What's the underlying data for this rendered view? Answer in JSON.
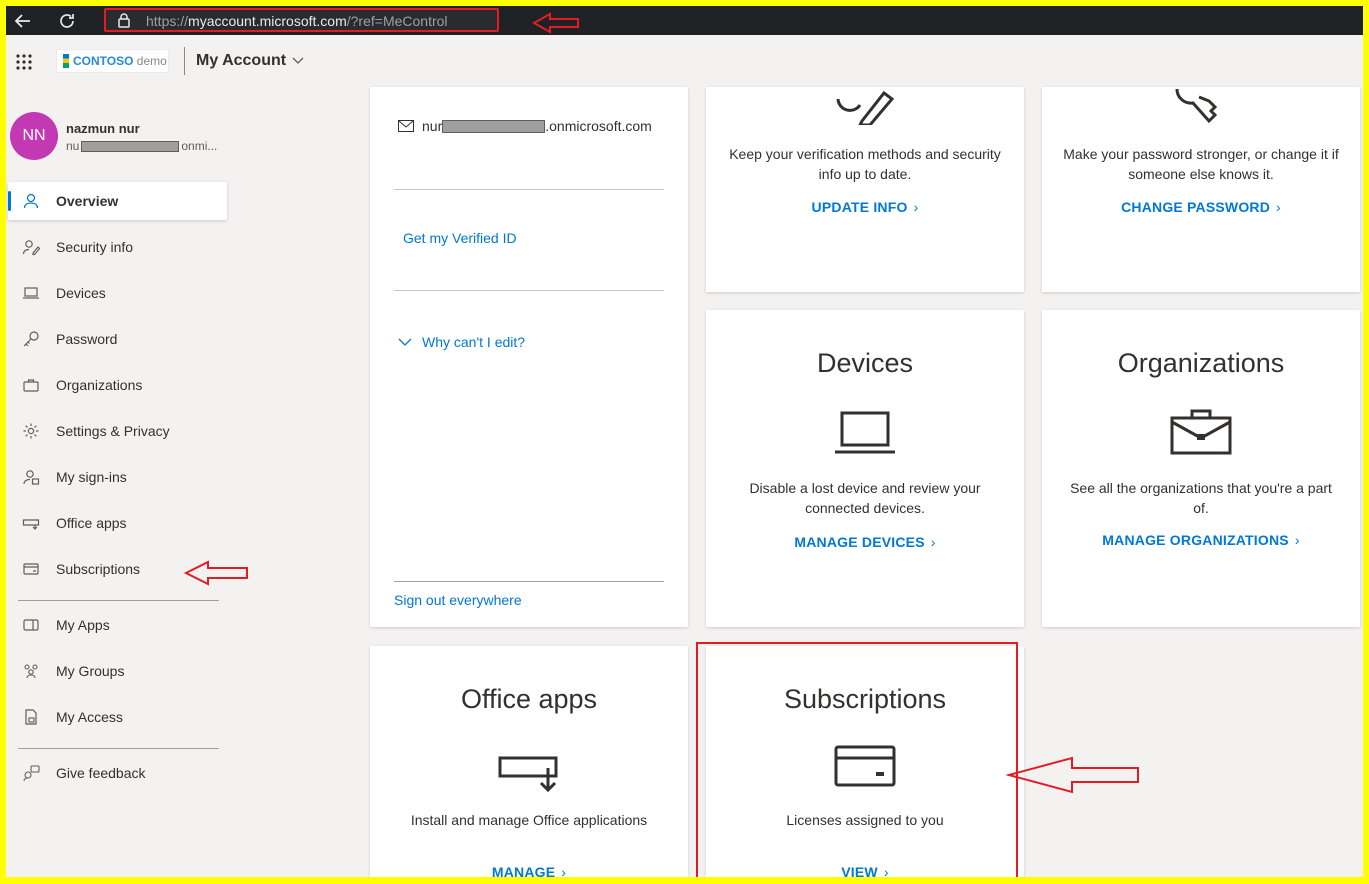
{
  "browser": {
    "url_prefix": "https://",
    "url_domain": "myaccount.microsoft.com",
    "url_suffix": "/?ref=MeControl"
  },
  "header": {
    "tenant_name": "CONTOSO",
    "tenant_suffix": "demo",
    "app_title": "My Account"
  },
  "user": {
    "initials": "NN",
    "name": "nazmun nur",
    "email_start": "nu",
    "email_end": "onmi..."
  },
  "sidebar": {
    "items": [
      {
        "label": "Overview",
        "icon": "person-icon"
      },
      {
        "label": "Security info",
        "icon": "security-info-icon"
      },
      {
        "label": "Devices",
        "icon": "laptop-icon"
      },
      {
        "label": "Password",
        "icon": "key-icon"
      },
      {
        "label": "Organizations",
        "icon": "briefcase-icon"
      },
      {
        "label": "Settings & Privacy",
        "icon": "gear-icon"
      },
      {
        "label": "My sign-ins",
        "icon": "sign-ins-icon"
      },
      {
        "label": "Office apps",
        "icon": "office-apps-icon"
      },
      {
        "label": "Subscriptions",
        "icon": "card-icon"
      },
      {
        "label": "My Apps",
        "icon": "my-apps-icon"
      },
      {
        "label": "My Groups",
        "icon": "groups-icon"
      },
      {
        "label": "My Access",
        "icon": "access-icon"
      },
      {
        "label": "Give feedback",
        "icon": "feedback-icon"
      }
    ]
  },
  "profile_card": {
    "email_start": "nur",
    "email_end": ".onmicrosoft.com",
    "verified_id": "Get my Verified ID",
    "why_cant_edit": "Why can't I edit?",
    "sign_out": "Sign out everywhere"
  },
  "cards": {
    "security": {
      "desc": "Keep your verification methods and security info up to date.",
      "link": "UPDATE INFO"
    },
    "password": {
      "desc": "Make your password stronger, or change it if someone else knows it.",
      "link": "CHANGE PASSWORD"
    },
    "devices": {
      "title": "Devices",
      "desc": "Disable a lost device and review your connected devices.",
      "link": "MANAGE DEVICES"
    },
    "organizations": {
      "title": "Organizations",
      "desc": "See all the organizations that you're a part of.",
      "link": "MANAGE ORGANIZATIONS"
    },
    "office_apps": {
      "title": "Office apps",
      "desc": "Install and manage Office applications",
      "link": "MANAGE"
    },
    "subscriptions": {
      "title": "Subscriptions",
      "desc": "Licenses assigned to you",
      "link": "VIEW"
    }
  },
  "colors": {
    "accent": "#0078d4",
    "avatar": "#c239b3",
    "annotation": "#e31b23",
    "screenshot_border": "#ffff00"
  }
}
